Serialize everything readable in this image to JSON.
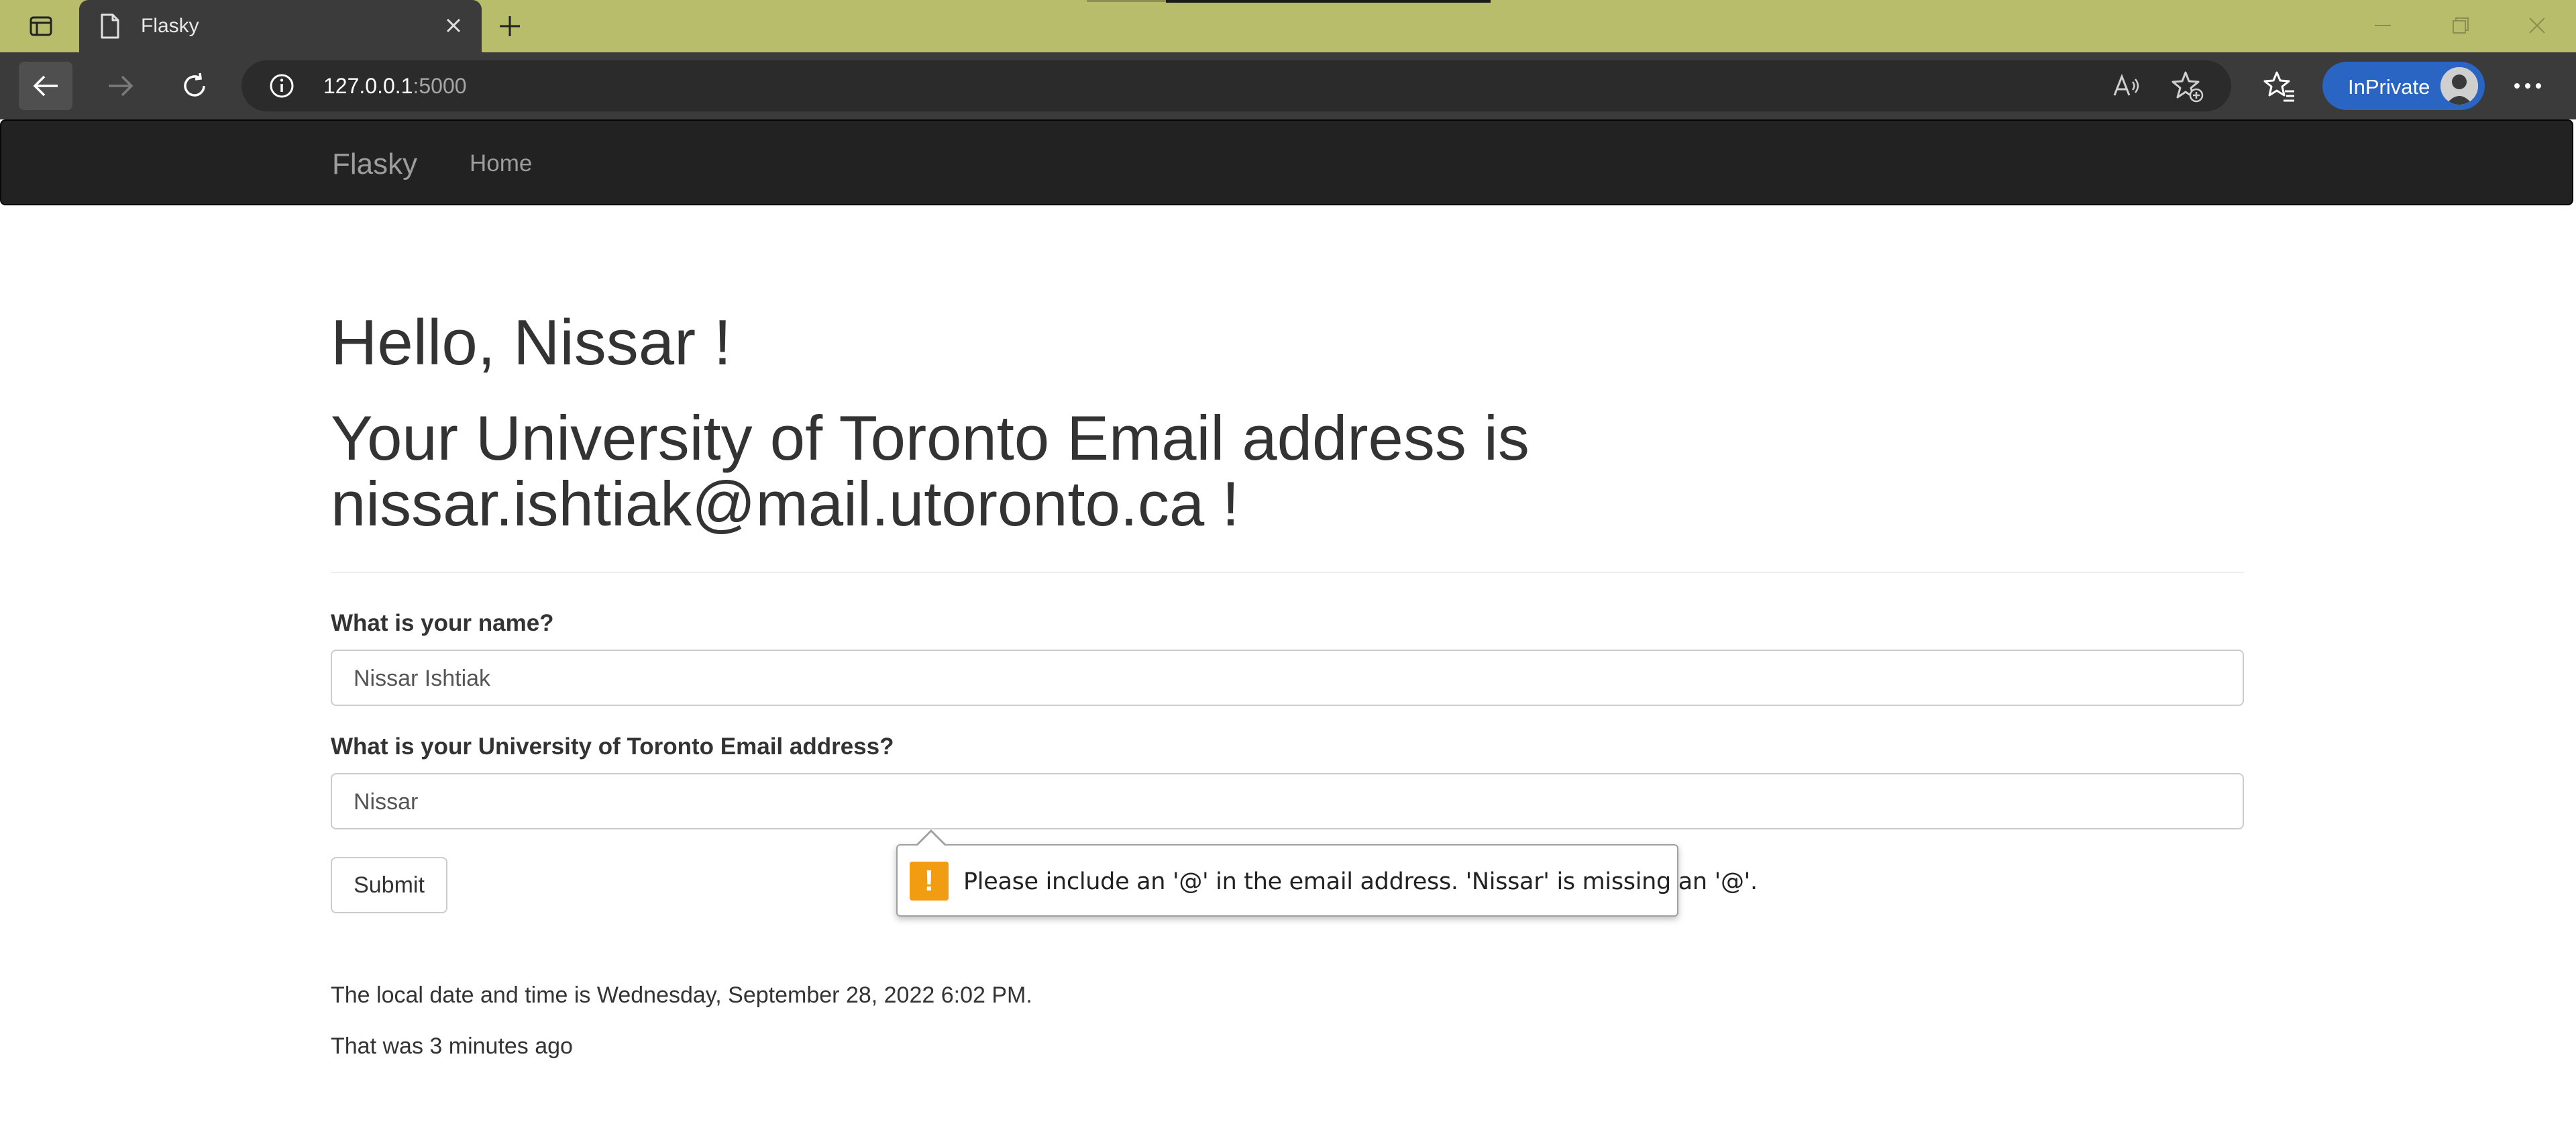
{
  "browser": {
    "tab_title": "Flasky",
    "url_host": "127.0.0.1",
    "url_port": ":5000",
    "inprivate_label": "InPrivate"
  },
  "navbar": {
    "brand": "Flasky",
    "home": "Home"
  },
  "main": {
    "greeting": "Hello, Nissar !",
    "email_message": "Your University of Toronto Email address is nissar.ishtiak@mail.utoronto.ca !",
    "name_label": "What is your name?",
    "name_value": "Nissar Ishtiak",
    "email_label": "What is your University of Toronto Email address?",
    "email_value": "Nissar",
    "submit_label": "Submit",
    "local_time": "The local date and time is Wednesday, September 28, 2022 6:02 PM.",
    "ago": "That was 3 minutes ago"
  },
  "tooltip": {
    "message": "Please include an '@' in the email address. 'Nissar' is missing an '@'."
  },
  "colors": {
    "tabstrip": "#b7bd6a",
    "toolbar": "#3b3b3b",
    "navbar": "#222222",
    "inprivate": "#2a65c4",
    "warning": "#f29c11"
  }
}
